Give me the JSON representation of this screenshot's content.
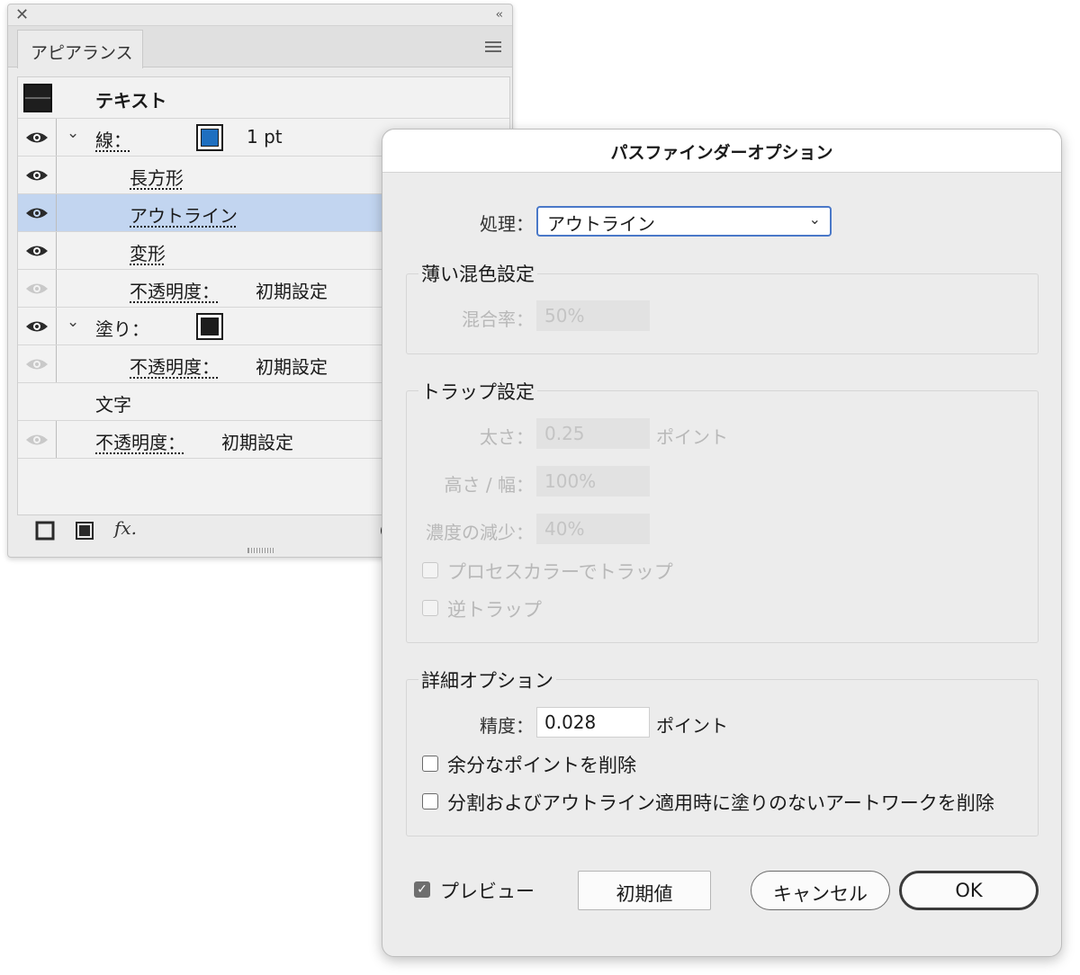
{
  "appearance_panel": {
    "tab_label": "アピアランス",
    "header_title": "テキスト",
    "rows": [
      {
        "label": "線：",
        "value": "1 pt"
      },
      {
        "label": "長方形"
      },
      {
        "label": "アウトライン"
      },
      {
        "label": "変形"
      },
      {
        "label": "不透明度：",
        "value": "初期設定"
      },
      {
        "label": "塗り："
      },
      {
        "label": "不透明度：",
        "value": "初期設定"
      },
      {
        "label": "文字"
      },
      {
        "label": "不透明度：",
        "value": "初期設定"
      }
    ],
    "fx_label": "fx."
  },
  "dialog": {
    "title": "パスファインダーオプション",
    "operation_label": "処理：",
    "operation_value": "アウトライン",
    "mix": {
      "group_title": "薄い混色設定",
      "rate_label": "混合率：",
      "rate_value": "50%"
    },
    "trap": {
      "group_title": "トラップ設定",
      "thickness_label": "太さ：",
      "thickness_value": "0.25",
      "thickness_unit": "ポイント",
      "height_width_label": "高さ / 幅：",
      "height_width_value": "100%",
      "tint_reduction_label": "濃度の減少：",
      "tint_reduction_value": "40%",
      "process_color_label": "プロセスカラーでトラップ",
      "reverse_label": "逆トラップ"
    },
    "advanced": {
      "group_title": "詳細オプション",
      "precision_label": "精度：",
      "precision_value": "0.028",
      "precision_unit": "ポイント",
      "remove_redundant_label": "余分なポイントを削除",
      "divide_outline_label": "分割およびアウトライン適用時に塗りのないアートワークを削除"
    },
    "preview_label": "プレビュー",
    "defaults_button": "初期値",
    "cancel_button": "キャンセル",
    "ok_button": "OK"
  },
  "colors": {
    "selection": "#c2d5f0",
    "stroke_swatch_blue": "#1e6fc0",
    "focus_ring": "#4a78c8"
  }
}
